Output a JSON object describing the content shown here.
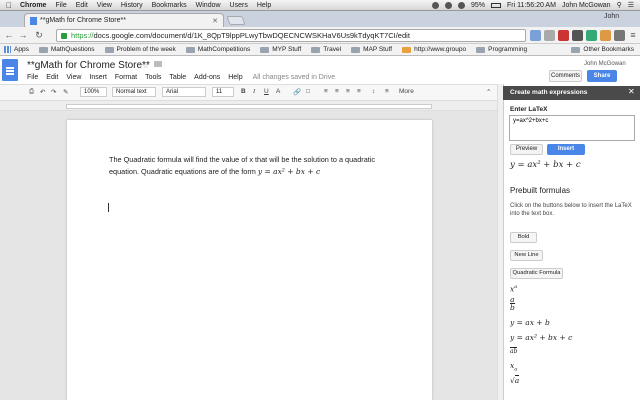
{
  "menubar": {
    "items": [
      "Chrome",
      "File",
      "Edit",
      "View",
      "History",
      "Bookmarks",
      "Window",
      "Users",
      "Help"
    ],
    "battery": "95%",
    "clock": "Fri 11:56:20 AM",
    "user": "John McGowan"
  },
  "browser": {
    "tab_title": "**gMath for Chrome Store**",
    "url_scheme": "https://",
    "url_rest": "docs.google.com/document/d/1K_8QpT9lppPLwyTbwDQECNCWSKHaV6Us9kTdyqKT7CI/edit",
    "profile": "John"
  },
  "bookmarks": {
    "items": [
      "Apps",
      "MathQuestions",
      "Problem of the week",
      "MathCompetitions",
      "MYP Stuff",
      "Travel",
      "MAP Stuff",
      "http://www.groupo",
      "Programming"
    ],
    "other": "Other Bookmarks"
  },
  "docs": {
    "title": "**gMath for Chrome Store**",
    "menu": [
      "File",
      "Edit",
      "View",
      "Insert",
      "Format",
      "Tools",
      "Table",
      "Add-ons",
      "Help"
    ],
    "save_status": "All changes saved in Drive",
    "account": "John McGowan",
    "comments_label": "Comments",
    "share_label": "Share",
    "toolbar": {
      "zoom": "100%",
      "style": "Normal text",
      "font": "Arial",
      "size": "11",
      "more": "More"
    },
    "paragraph_line1": "The Quadratic formula will find the value of x that will be the solution to a quadratic",
    "paragraph_line2": "equation. Quadratic equations are of the form",
    "paragraph_math": "y = ax² + bx + c"
  },
  "sidebar": {
    "title": "Create math expressions",
    "enter_label": "Enter LaTeX",
    "latex_value": "y=ax^2+bx+c",
    "preview_label": "Preview",
    "insert_label": "Insert",
    "preview_math": "y = ax² + bx + c",
    "prebuilt_title": "Prebuilt formulas",
    "prebuilt_desc": "Click on the buttons below to insert the LaTeX into the text box.",
    "buttons": [
      "Bold",
      "New Line",
      "Quadratic Formula"
    ],
    "formulas": {
      "power_base": "x",
      "power_exp": "a",
      "frac_num": "a",
      "frac_den": "b",
      "linear": "y = ax + b",
      "quadratic": "y = ax² + bx + c",
      "vector": "ab",
      "subscript_base": "x",
      "subscript_idx": "a",
      "sqrt_arg": "a"
    }
  }
}
